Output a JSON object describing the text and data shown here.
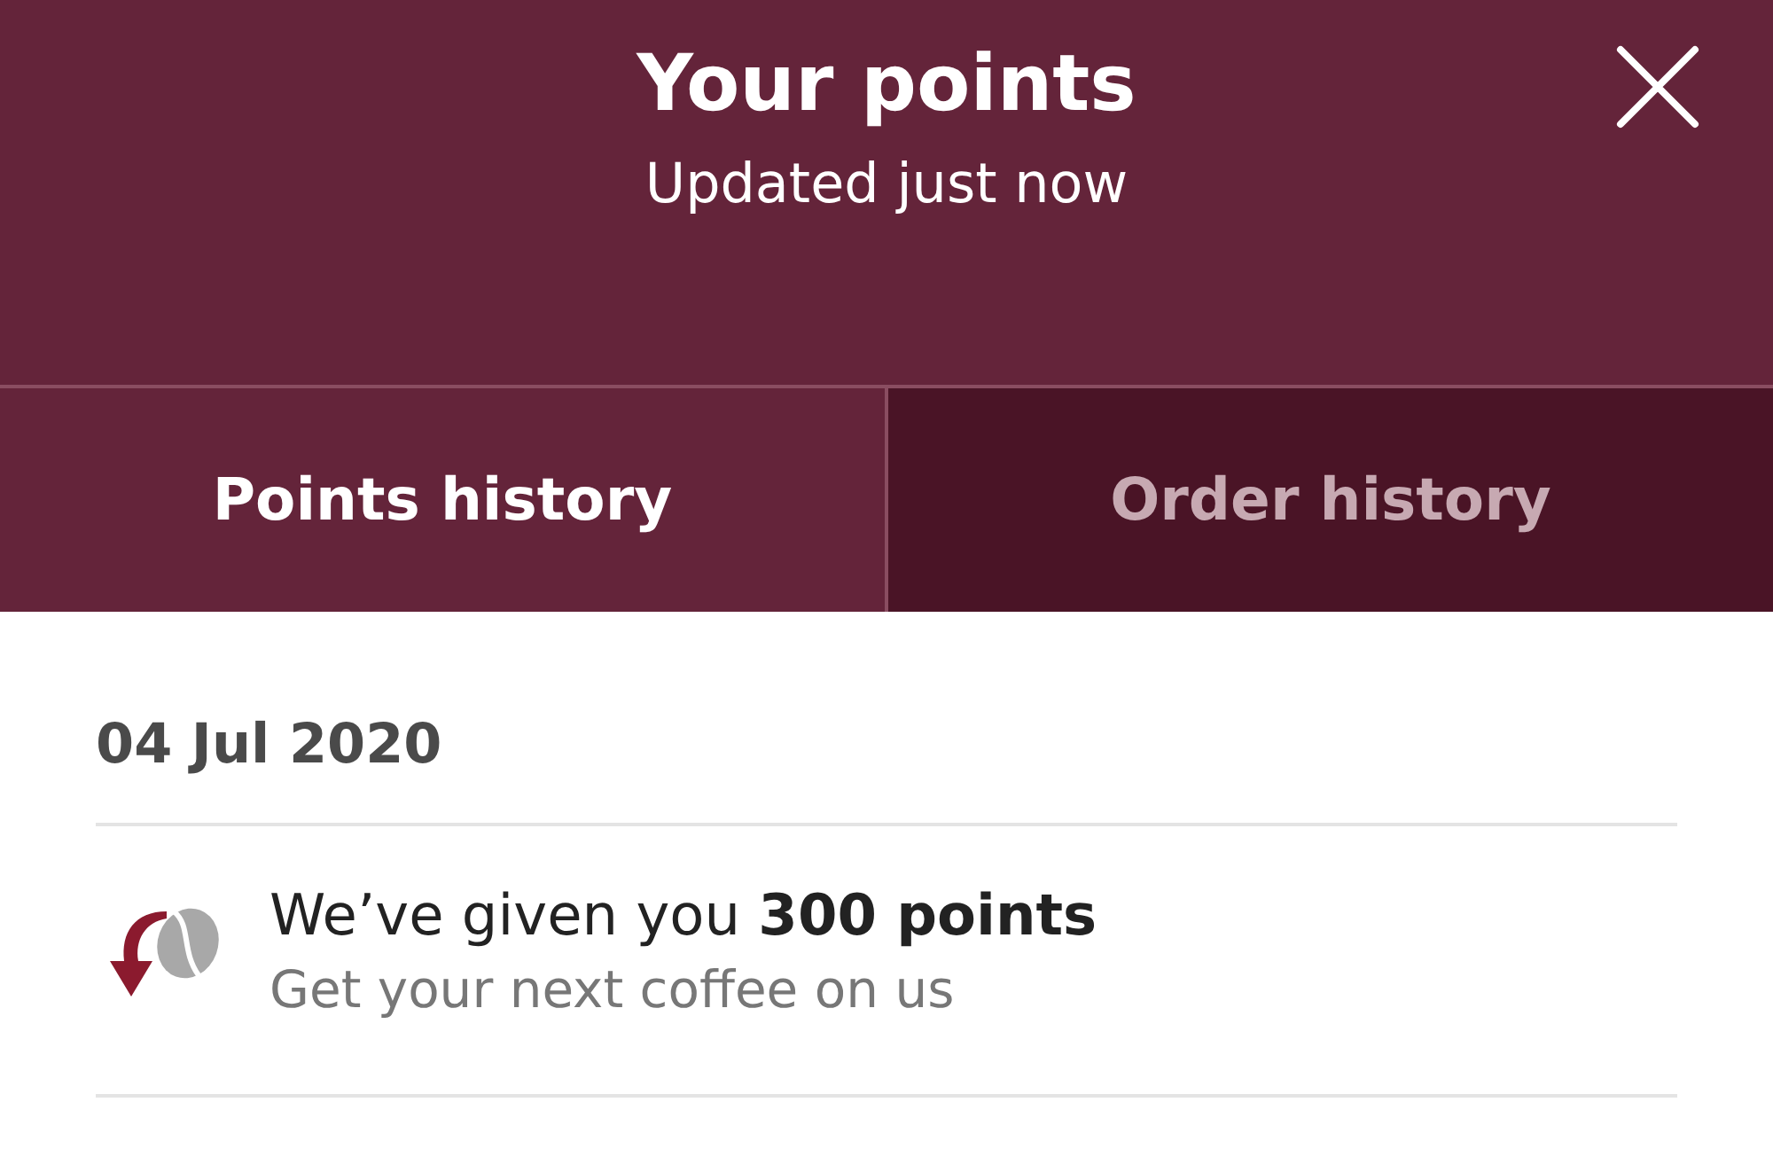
{
  "header": {
    "title": "Your points",
    "subtitle": "Updated just now"
  },
  "tabs": [
    {
      "label": "Points history",
      "selected": true
    },
    {
      "label": "Order history",
      "selected": false
    }
  ],
  "groups": [
    {
      "date": "04 Jul 2020",
      "entries": [
        {
          "title": "We’ve given you **300 points**",
          "detail": "Get your next coffee on us"
        }
      ]
    }
  ]
}
